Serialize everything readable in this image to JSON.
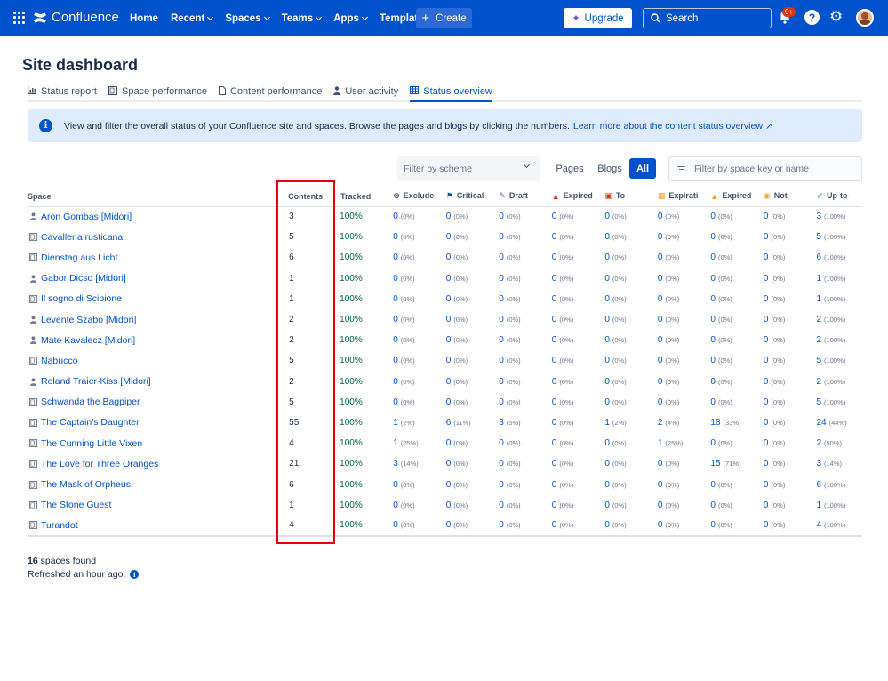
{
  "topnav": {
    "app_name": "Confluence",
    "items": [
      "Home",
      "Recent",
      "Spaces",
      "Teams",
      "Apps",
      "Templates"
    ],
    "dropdown_items": [
      false,
      true,
      true,
      true,
      true,
      false
    ],
    "create_label": "Create",
    "upgrade_label": "Upgrade",
    "search_placeholder": "Search",
    "notification_badge": "9+",
    "help_symbol": "?"
  },
  "page": {
    "title": "Site dashboard"
  },
  "tabs": [
    {
      "label": "Status report",
      "icon": "bar-chart-icon"
    },
    {
      "label": "Space performance",
      "icon": "space-icon"
    },
    {
      "label": "Content performance",
      "icon": "page-icon"
    },
    {
      "label": "User activity",
      "icon": "person-icon"
    },
    {
      "label": "Status overview",
      "icon": "table-icon",
      "active": true
    }
  ],
  "info": {
    "text": "View and filter the overall status of your Confluence site and spaces. Browse the pages and blogs by clicking the numbers.",
    "link": "Learn more about the content status overview",
    "link_icon": "↗"
  },
  "filters": {
    "scheme_placeholder": "Filter by scheme",
    "types": [
      "Pages",
      "Blogs",
      "All"
    ],
    "active_type": "All",
    "space_placeholder": "Filter by space key or name"
  },
  "table": {
    "headers": {
      "space": "Space",
      "contents": "Contents",
      "tracked": "Tracked",
      "cols": [
        {
          "label": "Exclude",
          "icon": "⊗",
          "color": "#42526e"
        },
        {
          "label": "Critical",
          "icon": "⚑",
          "color": "#0052cc"
        },
        {
          "label": "Draft",
          "icon": "✎",
          "color": "#6554c0"
        },
        {
          "label": "Expired",
          "icon": "▲",
          "color": "#de350b"
        },
        {
          "label": "To",
          "icon": "▣",
          "color": "#de350b"
        },
        {
          "label": "Expirati",
          "icon": "▦",
          "color": "#ff991f"
        },
        {
          "label": "Expired",
          "icon": "▲",
          "color": "#ff991f"
        },
        {
          "label": "Not",
          "icon": "◉",
          "color": "#ff991f"
        },
        {
          "label": "Up-to-",
          "icon": "✔",
          "color": "#36b37e"
        }
      ]
    },
    "rows": [
      {
        "icon": "person",
        "name": "Aron Gombas [Midori]",
        "contents": "3",
        "tracked": "100%",
        "cells": [
          [
            "0",
            "(0%)"
          ],
          [
            "0",
            "(0%)"
          ],
          [
            "0",
            "(0%)"
          ],
          [
            "0",
            "(0%)"
          ],
          [
            "0",
            "(0%)"
          ],
          [
            "0",
            "(0%)"
          ],
          [
            "0",
            "(0%)"
          ],
          [
            "0",
            "(0%)"
          ],
          [
            "3",
            "(100%)"
          ]
        ]
      },
      {
        "icon": "space",
        "name": "Cavalleria rusticana",
        "contents": "5",
        "tracked": "100%",
        "cells": [
          [
            "0",
            "(0%)"
          ],
          [
            "0",
            "(0%)"
          ],
          [
            "0",
            "(0%)"
          ],
          [
            "0",
            "(0%)"
          ],
          [
            "0",
            "(0%)"
          ],
          [
            "0",
            "(0%)"
          ],
          [
            "0",
            "(0%)"
          ],
          [
            "0",
            "(0%)"
          ],
          [
            "5",
            "(100%)"
          ]
        ]
      },
      {
        "icon": "space",
        "name": "Dienstag aus Licht",
        "contents": "6",
        "tracked": "100%",
        "cells": [
          [
            "0",
            "(0%)"
          ],
          [
            "0",
            "(0%)"
          ],
          [
            "0",
            "(0%)"
          ],
          [
            "0",
            "(0%)"
          ],
          [
            "0",
            "(0%)"
          ],
          [
            "0",
            "(0%)"
          ],
          [
            "0",
            "(0%)"
          ],
          [
            "0",
            "(0%)"
          ],
          [
            "6",
            "(100%)"
          ]
        ]
      },
      {
        "icon": "person",
        "name": "Gabor Dicso [Midori]",
        "contents": "1",
        "tracked": "100%",
        "cells": [
          [
            "0",
            "(0%)"
          ],
          [
            "0",
            "(0%)"
          ],
          [
            "0",
            "(0%)"
          ],
          [
            "0",
            "(0%)"
          ],
          [
            "0",
            "(0%)"
          ],
          [
            "0",
            "(0%)"
          ],
          [
            "0",
            "(0%)"
          ],
          [
            "0",
            "(0%)"
          ],
          [
            "1",
            "(100%)"
          ]
        ]
      },
      {
        "icon": "space",
        "name": "Il sogno di Scipione",
        "contents": "1",
        "tracked": "100%",
        "cells": [
          [
            "0",
            "(0%)"
          ],
          [
            "0",
            "(0%)"
          ],
          [
            "0",
            "(0%)"
          ],
          [
            "0",
            "(0%)"
          ],
          [
            "0",
            "(0%)"
          ],
          [
            "0",
            "(0%)"
          ],
          [
            "0",
            "(0%)"
          ],
          [
            "0",
            "(0%)"
          ],
          [
            "1",
            "(100%)"
          ]
        ]
      },
      {
        "icon": "person",
        "name": "Levente Szabo [Midori]",
        "contents": "2",
        "tracked": "100%",
        "cells": [
          [
            "0",
            "(0%)"
          ],
          [
            "0",
            "(0%)"
          ],
          [
            "0",
            "(0%)"
          ],
          [
            "0",
            "(0%)"
          ],
          [
            "0",
            "(0%)"
          ],
          [
            "0",
            "(0%)"
          ],
          [
            "0",
            "(0%)"
          ],
          [
            "0",
            "(0%)"
          ],
          [
            "2",
            "(100%)"
          ]
        ]
      },
      {
        "icon": "person",
        "name": "Mate Kavalecz [Midori]",
        "contents": "2",
        "tracked": "100%",
        "cells": [
          [
            "0",
            "(0%)"
          ],
          [
            "0",
            "(0%)"
          ],
          [
            "0",
            "(0%)"
          ],
          [
            "0",
            "(0%)"
          ],
          [
            "0",
            "(0%)"
          ],
          [
            "0",
            "(0%)"
          ],
          [
            "0",
            "(0%)"
          ],
          [
            "0",
            "(0%)"
          ],
          [
            "2",
            "(100%)"
          ]
        ]
      },
      {
        "icon": "space",
        "name": "Nabucco",
        "contents": "5",
        "tracked": "100%",
        "cells": [
          [
            "0",
            "(0%)"
          ],
          [
            "0",
            "(0%)"
          ],
          [
            "0",
            "(0%)"
          ],
          [
            "0",
            "(0%)"
          ],
          [
            "0",
            "(0%)"
          ],
          [
            "0",
            "(0%)"
          ],
          [
            "0",
            "(0%)"
          ],
          [
            "0",
            "(0%)"
          ],
          [
            "5",
            "(100%)"
          ]
        ]
      },
      {
        "icon": "person",
        "name": "Roland Traier-Kiss [Midori]",
        "contents": "2",
        "tracked": "100%",
        "cells": [
          [
            "0",
            "(0%)"
          ],
          [
            "0",
            "(0%)"
          ],
          [
            "0",
            "(0%)"
          ],
          [
            "0",
            "(0%)"
          ],
          [
            "0",
            "(0%)"
          ],
          [
            "0",
            "(0%)"
          ],
          [
            "0",
            "(0%)"
          ],
          [
            "0",
            "(0%)"
          ],
          [
            "2",
            "(100%)"
          ]
        ]
      },
      {
        "icon": "space",
        "name": "Schwanda the Bagpiper",
        "contents": "5",
        "tracked": "100%",
        "cells": [
          [
            "0",
            "(0%)"
          ],
          [
            "0",
            "(0%)"
          ],
          [
            "0",
            "(0%)"
          ],
          [
            "0",
            "(0%)"
          ],
          [
            "0",
            "(0%)"
          ],
          [
            "0",
            "(0%)"
          ],
          [
            "0",
            "(0%)"
          ],
          [
            "0",
            "(0%)"
          ],
          [
            "5",
            "(100%)"
          ]
        ]
      },
      {
        "icon": "space",
        "name": "The Captain's Daughter",
        "contents": "55",
        "tracked": "100%",
        "cells": [
          [
            "1",
            "(2%)"
          ],
          [
            "6",
            "(11%)"
          ],
          [
            "3",
            "(5%)"
          ],
          [
            "0",
            "(0%)"
          ],
          [
            "1",
            "(2%)"
          ],
          [
            "2",
            "(4%)"
          ],
          [
            "18",
            "(33%)"
          ],
          [
            "0",
            "(0%)"
          ],
          [
            "24",
            "(44%)"
          ]
        ]
      },
      {
        "icon": "space",
        "name": "The Cunning Little Vixen",
        "contents": "4",
        "tracked": "100%",
        "cells": [
          [
            "1",
            "(25%)"
          ],
          [
            "0",
            "(0%)"
          ],
          [
            "0",
            "(0%)"
          ],
          [
            "0",
            "(0%)"
          ],
          [
            "0",
            "(0%)"
          ],
          [
            "1",
            "(25%)"
          ],
          [
            "0",
            "(0%)"
          ],
          [
            "0",
            "(0%)"
          ],
          [
            "2",
            "(50%)"
          ]
        ]
      },
      {
        "icon": "space",
        "name": "The Love for Three Oranges",
        "contents": "21",
        "tracked": "100%",
        "cells": [
          [
            "3",
            "(14%)"
          ],
          [
            "0",
            "(0%)"
          ],
          [
            "0",
            "(0%)"
          ],
          [
            "0",
            "(0%)"
          ],
          [
            "0",
            "(0%)"
          ],
          [
            "0",
            "(0%)"
          ],
          [
            "15",
            "(71%)"
          ],
          [
            "0",
            "(0%)"
          ],
          [
            "3",
            "(14%)"
          ]
        ]
      },
      {
        "icon": "space",
        "name": "The Mask of Orpheus",
        "contents": "6",
        "tracked": "100%",
        "cells": [
          [
            "0",
            "(0%)"
          ],
          [
            "0",
            "(0%)"
          ],
          [
            "0",
            "(0%)"
          ],
          [
            "0",
            "(0%)"
          ],
          [
            "0",
            "(0%)"
          ],
          [
            "0",
            "(0%)"
          ],
          [
            "0",
            "(0%)"
          ],
          [
            "0",
            "(0%)"
          ],
          [
            "6",
            "(100%)"
          ]
        ]
      },
      {
        "icon": "space",
        "name": "The Stone Guest",
        "contents": "1",
        "tracked": "100%",
        "cells": [
          [
            "0",
            "(0%)"
          ],
          [
            "0",
            "(0%)"
          ],
          [
            "0",
            "(0%)"
          ],
          [
            "0",
            "(0%)"
          ],
          [
            "0",
            "(0%)"
          ],
          [
            "0",
            "(0%)"
          ],
          [
            "0",
            "(0%)"
          ],
          [
            "0",
            "(0%)"
          ],
          [
            "1",
            "(100%)"
          ]
        ]
      },
      {
        "icon": "space",
        "name": "Turandot",
        "contents": "4",
        "tracked": "100%",
        "cells": [
          [
            "0",
            "(0%)"
          ],
          [
            "0",
            "(0%)"
          ],
          [
            "0",
            "(0%)"
          ],
          [
            "0",
            "(0%)"
          ],
          [
            "0",
            "(0%)"
          ],
          [
            "0",
            "(0%)"
          ],
          [
            "0",
            "(0%)"
          ],
          [
            "0",
            "(0%)"
          ],
          [
            "4",
            "(100%)"
          ]
        ]
      }
    ]
  },
  "footer": {
    "count": "16",
    "count_suffix": "spaces found",
    "refreshed": "Refreshed an hour ago."
  },
  "colors": {
    "brand": "#0052cc",
    "tracked_green": "#006644",
    "highlight": "#e8000b"
  }
}
